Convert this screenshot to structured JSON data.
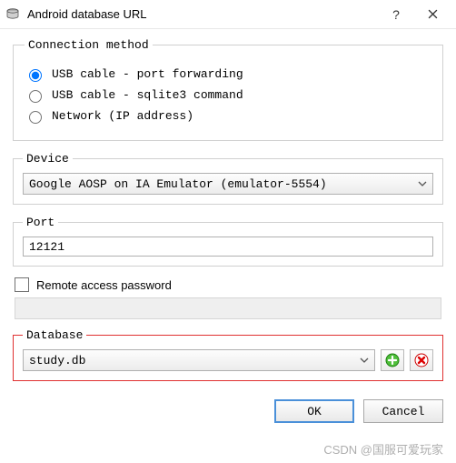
{
  "window": {
    "title": "Android database URL"
  },
  "groups": {
    "connection": {
      "legend": "Connection method",
      "options": {
        "usb_port": "USB cable - port forwarding",
        "usb_sqlite": "USB cable - sqlite3 command",
        "network": "Network (IP address)"
      },
      "selected": "usb_port"
    },
    "device": {
      "legend": "Device",
      "value": "Google AOSP on IA Emulator (emulator-5554)"
    },
    "port": {
      "legend": "Port",
      "value": "12121"
    },
    "password": {
      "label": "Remote access password",
      "checked": false,
      "value": ""
    },
    "database": {
      "legend": "Database",
      "value": "study.db"
    }
  },
  "buttons": {
    "ok": "OK",
    "cancel": "Cancel"
  },
  "watermark": "CSDN @国服可爱玩家"
}
